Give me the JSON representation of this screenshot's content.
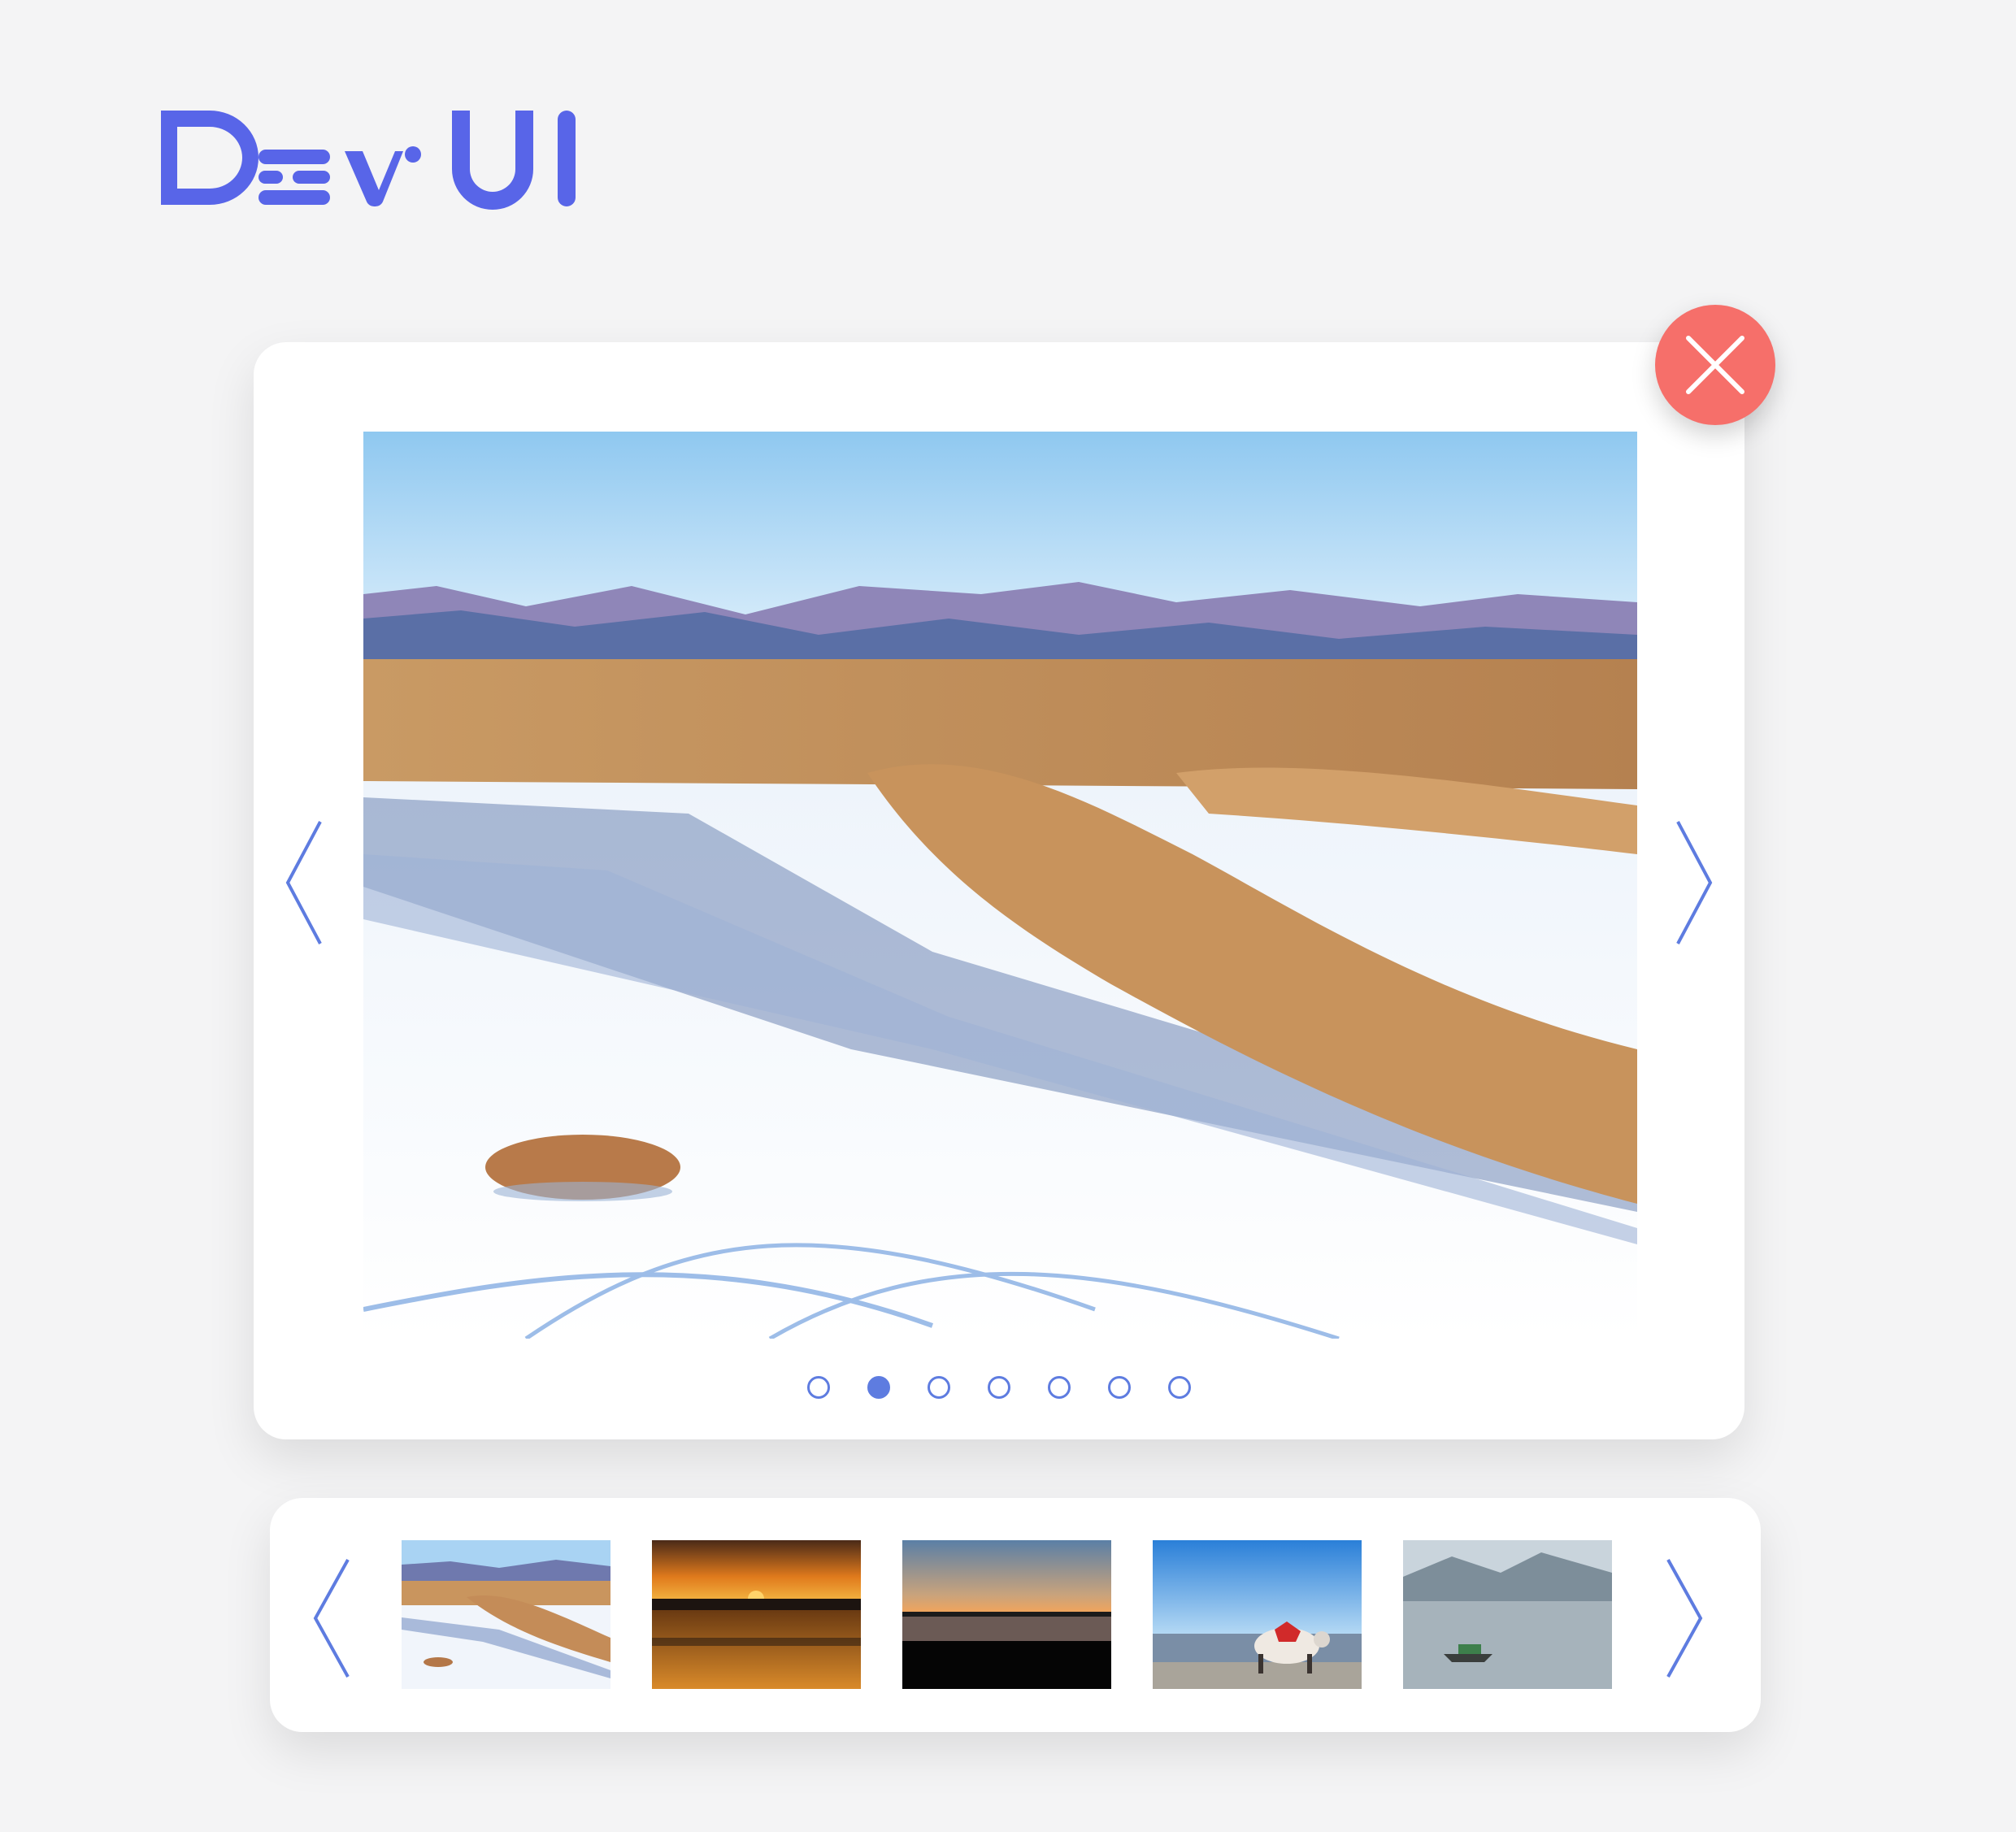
{
  "brand": {
    "logo_text": "DevUI",
    "accent_color": "#5e7ce0",
    "close_color": "#f66f6a"
  },
  "viewer": {
    "image_description_icon": "winter-landscape-image",
    "slide_count": 7,
    "active_slide": 2,
    "prev_icon": "chevron-left-icon",
    "next_icon": "chevron-right-icon",
    "close_icon": "close-icon"
  },
  "thumbnails": {
    "items": [
      {
        "name": "snowy-hills-thumbnail"
      },
      {
        "name": "sunset-lake-thumbnail"
      },
      {
        "name": "dusk-horizon-thumbnail"
      },
      {
        "name": "yak-beach-thumbnail"
      },
      {
        "name": "boat-lake-thumbnail"
      }
    ],
    "prev_icon": "chevron-left-icon",
    "next_icon": "chevron-right-icon"
  }
}
